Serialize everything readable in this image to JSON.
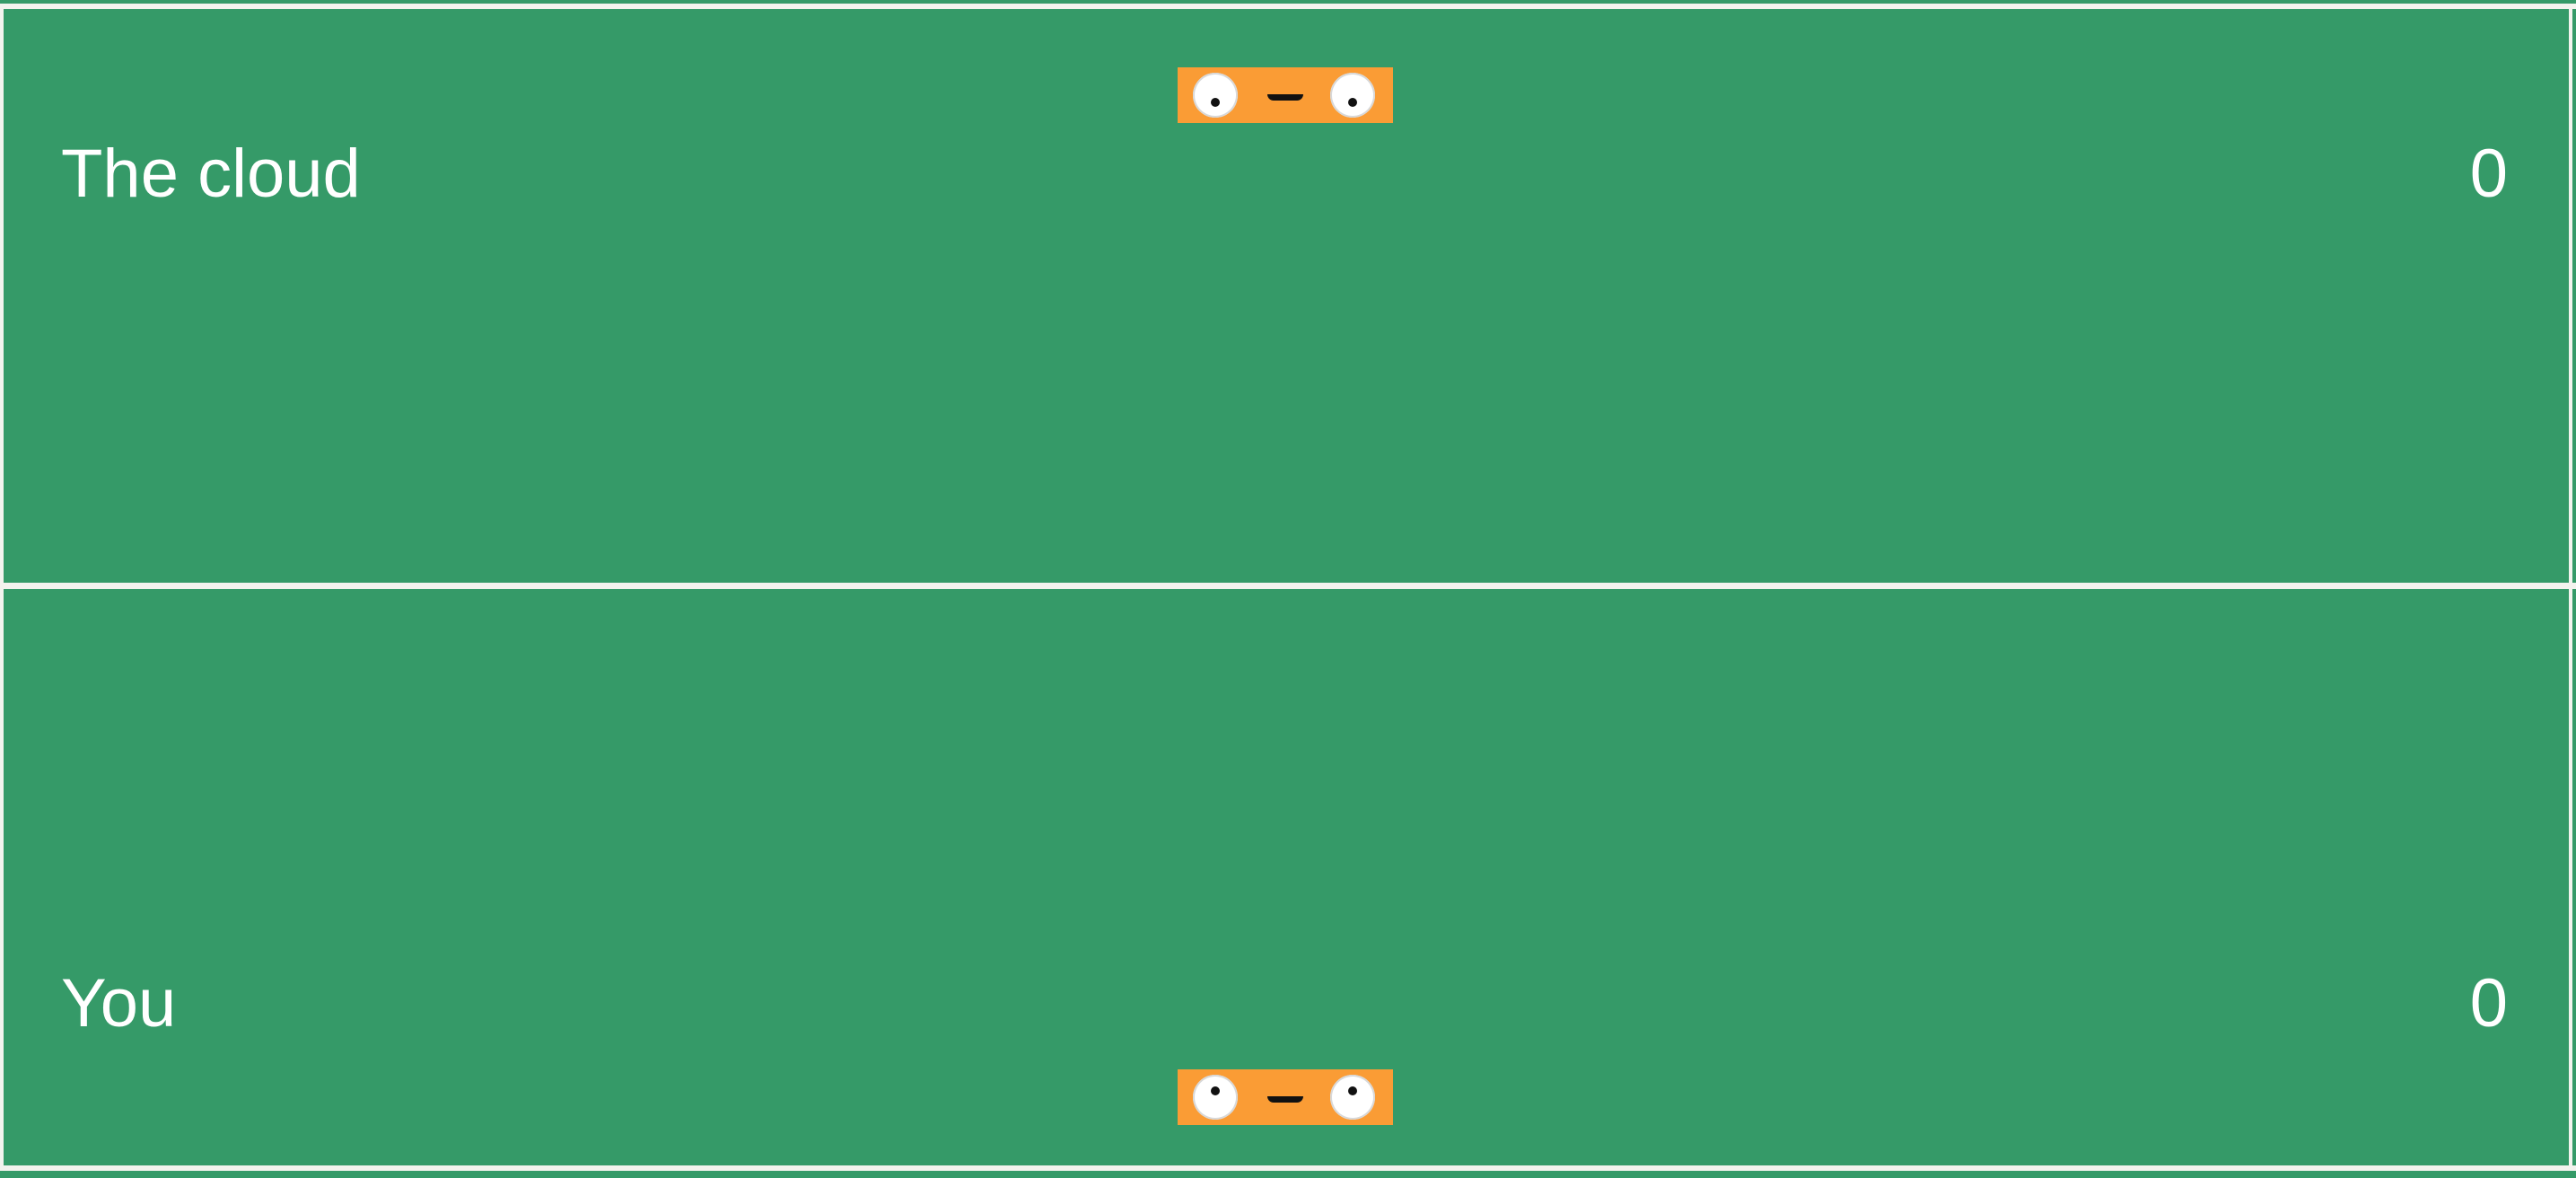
{
  "game": {
    "opponent": {
      "name": "The cloud",
      "score": "0"
    },
    "player": {
      "name": "You",
      "score": "0"
    }
  },
  "colors": {
    "court": "#359a68",
    "lines": "#f3f3ee",
    "paddle": "#fa9c35",
    "text": "#ffffff"
  }
}
